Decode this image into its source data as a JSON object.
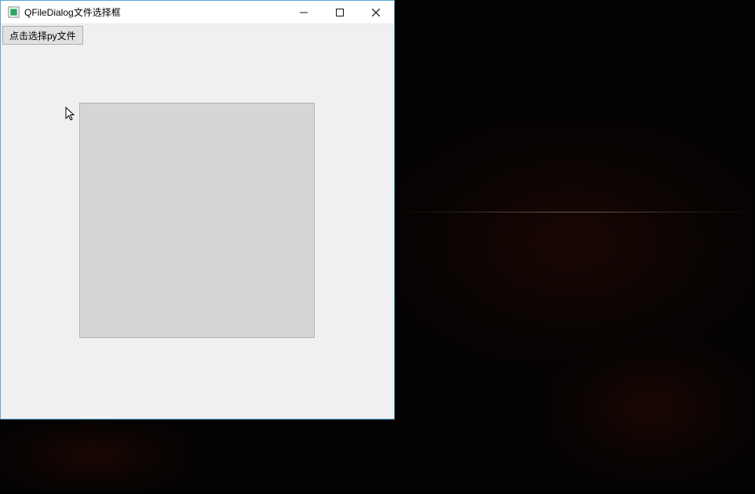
{
  "window": {
    "title": "QFileDialog文件选择框",
    "controls": {
      "minimize_name": "minimize-button",
      "maximize_name": "maximize-button",
      "close_name": "close-button"
    }
  },
  "client": {
    "select_button_label": "点击选择py文件",
    "label_text": ""
  }
}
